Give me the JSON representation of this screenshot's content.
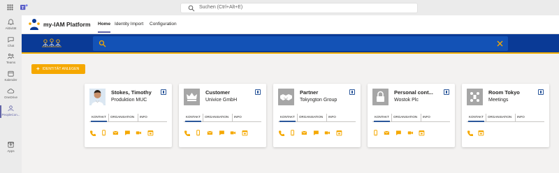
{
  "teams": {
    "search_placeholder": "Suchen (Ctrl+Alt+E)",
    "rail": [
      {
        "label": "Aktivität",
        "icon": "bell-icon"
      },
      {
        "label": "Chat",
        "icon": "chat-icon"
      },
      {
        "label": "Teams",
        "icon": "teams-icon"
      },
      {
        "label": "Kalender",
        "icon": "calendar-icon"
      },
      {
        "label": "OneDrive",
        "icon": "cloud-icon"
      },
      {
        "label": "PeopleCon...",
        "icon": "peoplecon-icon",
        "active": true
      },
      {
        "label": "Apps",
        "icon": "apps-icon"
      }
    ],
    "more": "•••"
  },
  "app": {
    "title": "my-IAM Platform",
    "tabs": [
      "Home",
      "Identity Import",
      "Configuration"
    ],
    "active_tab": "Home"
  },
  "banner": {
    "search_value": ""
  },
  "add_button": {
    "label": "IDENTITÄT ANLEGEN"
  },
  "card_tabs": [
    "KONTAKT",
    "ORGANISATION",
    "INFO"
  ],
  "cards": [
    {
      "name": "Stokes, Timothy",
      "subtitle": "Produktion MUC",
      "photo": "person-photo",
      "actions": [
        "phone-icon",
        "mobile-icon",
        "mail-icon",
        "chat-icon",
        "video-icon",
        "calendar-icon"
      ]
    },
    {
      "name": "Customer",
      "subtitle": "Univice GmbH",
      "photo": "crown-icon",
      "actions": [
        "phone-icon",
        "mobile-icon",
        "mail-icon",
        "chat-icon",
        "video-icon",
        "calendar-icon"
      ]
    },
    {
      "name": "Partner",
      "subtitle": "Tokyngton Group",
      "photo": "handshake-icon",
      "actions": [
        "phone-icon",
        "mobile-icon",
        "mail-icon",
        "chat-icon",
        "video-icon",
        "calendar-icon"
      ]
    },
    {
      "name": "Personal cont...",
      "subtitle": "Wostok Plc",
      "photo": "lock-icon",
      "actions": [
        "mobile-icon",
        "mail-icon",
        "chat-icon",
        "video-icon",
        "calendar-icon"
      ]
    },
    {
      "name": "Room Tokyo",
      "subtitle": "Meetings",
      "photo": "meeting-room-icon",
      "actions": [
        "phone-icon",
        "calendar-icon"
      ]
    }
  ],
  "colors": {
    "brand_blue": "#0a3a96",
    "accent_orange": "#f5a800",
    "teams_purple": "#6264a7"
  }
}
